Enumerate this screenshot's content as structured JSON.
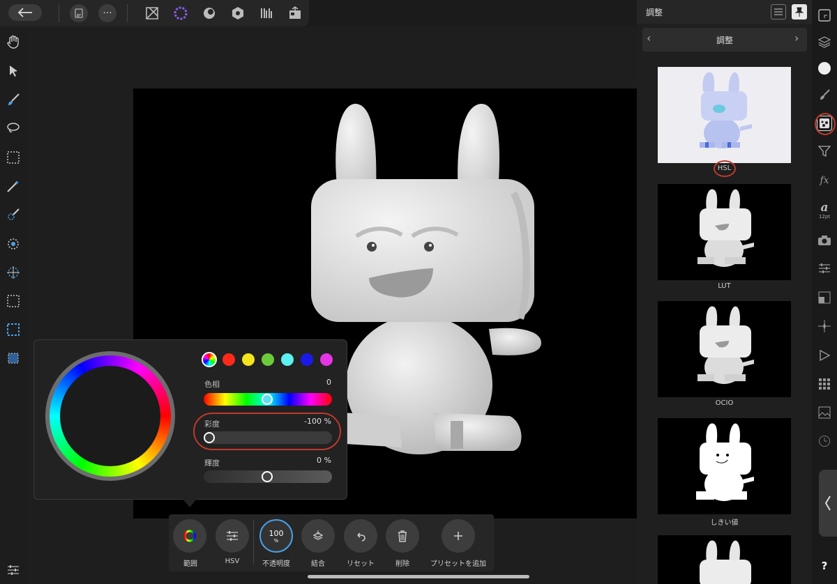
{
  "toolbar": {
    "back": "back-arrow",
    "document_icon": "document-icon",
    "more_label": "···",
    "personas": [
      "photo-persona-icon",
      "liquify-persona-icon",
      "develop-persona-icon",
      "tone-mapping-persona-icon",
      "export-persona-icon",
      "share-icon"
    ]
  },
  "left_tools": [
    "hand-tool",
    "move-tool",
    "brush-tool",
    "lasso-tool",
    "marquee-tool",
    "magic-wand-tool",
    "selection-brush-tool",
    "flood-select-tool",
    "refine-tool",
    "quick-mask-tool",
    "selection-tool",
    "crop-tool"
  ],
  "popup": {
    "hue_label": "色相",
    "hue_value": "0",
    "saturation_label": "彩度",
    "saturation_value": "-100 %",
    "luminosity_label": "輝度",
    "luminosity_value": "0 %",
    "swatches": [
      "#ff0000",
      "#f5e51a",
      "#6ccb3a",
      "#5ef0f0",
      "#1a1ae8",
      "#e535e5"
    ]
  },
  "context_bar": {
    "range_label": "範囲",
    "hsv_label": "HSV",
    "opacity_value": "100",
    "opacity_unit": "%",
    "opacity_label": "不透明度",
    "merge_label": "結合",
    "reset_label": "リセット",
    "delete_label": "削除",
    "add_preset_label": "プリセットを追加"
  },
  "right_panel": {
    "title": "調整",
    "sub_title": "調整",
    "presets": [
      "HSL",
      "LUT",
      "OCIO",
      "しきい値"
    ]
  },
  "studio": {
    "font_size_label": "12pt",
    "help_label": "?"
  },
  "colors": {
    "accent": "#4aa1e8",
    "annotation": "#c0392b"
  }
}
